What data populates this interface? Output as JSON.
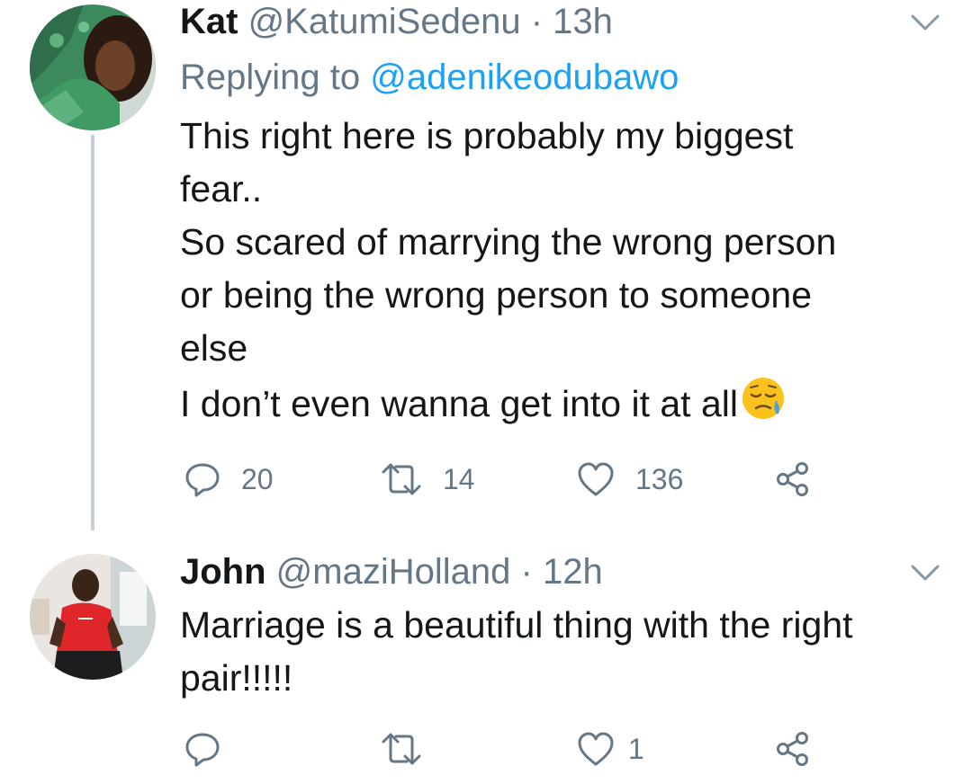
{
  "tweets": [
    {
      "display_name": "Kat",
      "handle": "@KatumiSedenu",
      "separator": "·",
      "time": "13h",
      "replying_prefix": "Replying to",
      "replying_to": "@adenikeodubawo",
      "text_lines": [
        "This right here is probably my biggest",
        "fear..",
        "So scared of marrying the wrong person",
        "or being the wrong person to someone",
        "else",
        "I don’t even wanna get into it at all"
      ],
      "emoji": "disappointed-relieved-face-emoji",
      "replies": "20",
      "retweets": "14",
      "likes": "136"
    },
    {
      "display_name": "John",
      "handle": "@maziHolland",
      "separator": "·",
      "time": "12h",
      "text_lines": [
        "Marriage is a beautiful thing with the right",
        "pair!!!!!"
      ],
      "replies": "",
      "retweets": "",
      "likes": "1"
    }
  ],
  "icons": {
    "reply": "reply-icon",
    "retweet": "retweet-icon",
    "like": "heart-icon",
    "share": "share-icon",
    "more": "chevron-down-icon"
  },
  "colors": {
    "text": "#14171a",
    "muted": "#657786",
    "link": "#1da1f2",
    "thread_line": "#c4cfd6"
  }
}
